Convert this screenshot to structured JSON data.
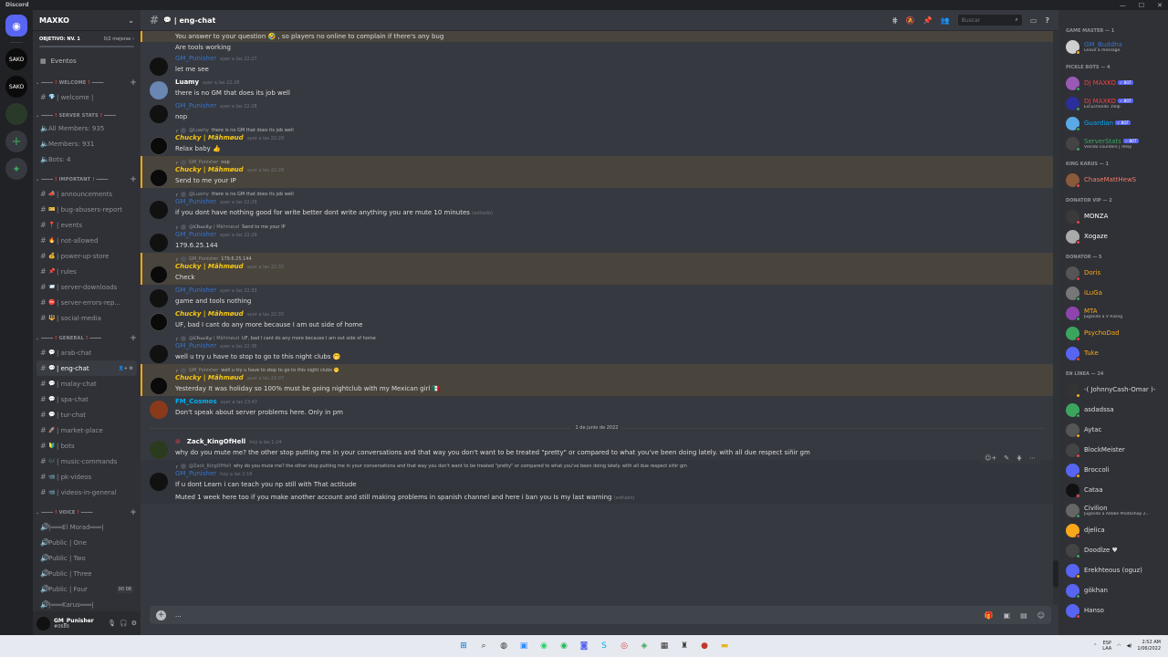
{
  "titlebar": {
    "app": "Discord",
    "min": "—",
    "max": "☐",
    "close": "✕"
  },
  "guilds": [
    "SAKO",
    "SAKO",
    ""
  ],
  "server": {
    "name": "MAXKO",
    "objective": "OBJETIVO: NV. 1",
    "objective_progress": "0/2 mejoras",
    "objective_fraction": 0.0,
    "events": "Eventos"
  },
  "categories": {
    "welcome": "WELCOME",
    "server_stats": "SERVER STATS",
    "important": "IMPORTANT",
    "general": "GENERAL",
    "voice": "VOICE"
  },
  "channels": {
    "welcome": [
      {
        "emoji": "💎",
        "name": "| welcome |"
      }
    ],
    "stats": [
      {
        "name": "All Members: 935"
      },
      {
        "name": "Members: 931"
      },
      {
        "name": "Bots: 4"
      }
    ],
    "important": [
      {
        "emoji": "📣",
        "name": "| announcements"
      },
      {
        "emoji": "🎫",
        "name": "| bug-abusers-report"
      },
      {
        "emoji": "📍",
        "name": "| events"
      },
      {
        "emoji": "🔥",
        "name": "| not-allowed"
      },
      {
        "emoji": "💰",
        "name": "| power-up-store"
      },
      {
        "emoji": "📌",
        "name": "| rules"
      },
      {
        "emoji": "📨",
        "name": "| server-downloads"
      },
      {
        "emoji": "⛔",
        "name": "| server-errors-rep..."
      },
      {
        "emoji": "🔱",
        "name": "| social-media"
      }
    ],
    "general": [
      {
        "emoji": "💬",
        "name": "| arab-chat"
      },
      {
        "emoji": "💬",
        "name": "| eng-chat",
        "active": true
      },
      {
        "emoji": "💬",
        "name": "| malay-chat"
      },
      {
        "emoji": "💬",
        "name": "| spa-chat"
      },
      {
        "emoji": "💬",
        "name": "| tur-chat"
      },
      {
        "emoji": "🚀",
        "name": "| market-place"
      },
      {
        "emoji": "🔰",
        "name": "| bots"
      },
      {
        "emoji": "🎶",
        "name": "| music-commands"
      },
      {
        "emoji": "📹",
        "name": "| pk-videos"
      },
      {
        "emoji": "📹",
        "name": "| videos-in-general"
      }
    ],
    "voice": [
      {
        "name": "|═══El Morad═══|",
        "plain": true
      },
      {
        "name": "Public | One"
      },
      {
        "name": "Public | Two"
      },
      {
        "name": "Public | Three"
      },
      {
        "name": "Public | Four",
        "badge": "00  08"
      },
      {
        "name": "|═══Karus═══|",
        "plain": true
      }
    ]
  },
  "user_panel": {
    "name": "GM_Punisher",
    "tag": "#0686"
  },
  "channel": {
    "name": "| eng-chat",
    "search_placeholder": "Buscar"
  },
  "messages": [
    {
      "type": "cont",
      "hl": true,
      "text": "You answer to your question 🤣 , so players no online to complain if there's any bug"
    },
    {
      "type": "cont",
      "text": "Are tools working"
    },
    {
      "type": "full",
      "author": "GM_Punisher",
      "style": "gm",
      "av": "gm",
      "ts": "ayer a las 22:27",
      "text": "let me see"
    },
    {
      "type": "full",
      "author": "Luamy",
      "style": "white",
      "av": "luamy",
      "ts": "ayer a las 22:28",
      "text": "there is no GM that does its job well"
    },
    {
      "type": "full",
      "author": "GM_Punisher",
      "style": "gm",
      "av": "gm",
      "ts": "ayer a las 22:28",
      "text": "nop"
    },
    {
      "type": "full",
      "reply_name": "@Luamy",
      "reply_text": "there is no GM that does its job well",
      "author": "𝘾𝙝𝙪𝙘𝙠𝙮 | Mâhmøud",
      "style": "gold",
      "av": "chucky",
      "ts": "ayer a las 22:28",
      "text": "Relax baby 👍"
    },
    {
      "type": "full",
      "hl": true,
      "reply_name": "GM_Punisher",
      "reply_text": "nop",
      "author": "𝘾𝙝𝙪𝙘𝙠𝙮 | Mâhmøud",
      "style": "gold",
      "av": "chucky",
      "ts": "ayer a las 22:28",
      "text": "Send to me your IP"
    },
    {
      "type": "full",
      "reply_name": "@Luamy",
      "reply_text": "there is no GM that does its job well",
      "author": "GM_Punisher",
      "style": "gm",
      "av": "gm",
      "ts": "ayer a las 22:29",
      "text": "if you dont have nothing good for write better dont write anything you are mute 10 minutes",
      "edited": "(editado)"
    },
    {
      "type": "full",
      "reply_name": "@𝘾𝙝𝙪𝙘𝙠𝙮 | Mâhmøud",
      "reply_text": "Send to me your IP",
      "author": "GM_Punisher",
      "style": "gm",
      "av": "gm",
      "ts": "ayer a las 22:29",
      "text": "179.6.25.144"
    },
    {
      "type": "full",
      "hl": true,
      "reply_name": "GM_Punisher",
      "reply_text": "179.6.25.144",
      "author": "𝘾𝙝𝙪𝙘𝙠𝙮 | Mâhmøud",
      "style": "gold",
      "av": "chucky",
      "ts": "ayer a las 22:32",
      "text": "Check"
    },
    {
      "type": "full",
      "author": "GM_Punisher",
      "style": "gm",
      "av": "gm",
      "ts": "ayer a las 22:33",
      "text": "game and tools nothing"
    },
    {
      "type": "full",
      "author": "𝘾𝙝𝙪𝙘𝙠𝙮 | Mâhmøud",
      "style": "gold",
      "av": "chucky",
      "ts": "ayer a las 22:35",
      "text": "UF, bad I cant do any more because I am out side of home"
    },
    {
      "type": "full",
      "reply_name": "@𝘾𝙝𝙪𝙘𝙠𝙮 | Mâhmøud",
      "reply_text": "UF, bad I cant do any more because I am out side of home",
      "author": "GM_Punisher",
      "style": "gm",
      "av": "gm",
      "ts": "ayer a las 22:36",
      "text": "well u try u have to stop to go to this night clubs 🤭"
    },
    {
      "type": "full",
      "hl": true,
      "reply_name": "GM_Punisher",
      "reply_text": "well u try u have to stop to go to this night clubs 🤭",
      "author": "𝘾𝙝𝙪𝙘𝙠𝙮 | Mâhmøud",
      "style": "gold",
      "av": "chucky",
      "ts": "ayer a las 23:07",
      "text": "Yesterday It was holiday so 100% must be going nightclub with my Mexican girl 🇲🇽"
    },
    {
      "type": "full",
      "author": "FM_Cosmos",
      "style": "cosmos",
      "av": "cosmos",
      "ts": "ayer a las 23:47",
      "text": "Don't speak about server problems here. Only in pm"
    },
    {
      "type": "date",
      "text": "1 de junio de 2022"
    },
    {
      "type": "full",
      "author": "Zack_KingOfHell",
      "style": "white",
      "av": "zack",
      "ts": "hoy a las 1:24",
      "notice": "⊘",
      "text": "why do you mute me? the other stop putting me in your conversations and that way you don't want to be treated \"pretty\" or compared to what you've been doing lately. with all due respect siñir gm"
    },
    {
      "type": "full",
      "hover": true,
      "actions": true,
      "reply_name": "@Zack_KingOfHell",
      "reply_text": "why do you mute me? the other stop putting me in your conversations and that way you don't want to be treated \"pretty\" or compared to what you've been doing lately. with all due respect siñir gm",
      "author": "GM_Punisher",
      "style": "gm",
      "av": "gm",
      "ts": "hoy a las 2:16",
      "text": "If u dont Learn i can teach you np still with That actitude"
    },
    {
      "type": "cont",
      "hover": true,
      "text": "Muted 1 week here too if you make another account and still making problems in spanish channel and here i ban you Is my last warning",
      "edited": "(editado)"
    }
  ],
  "composer": {
    "placeholder": "..."
  },
  "members": [
    {
      "cat": "GAME MASTER — 1",
      "items": [
        {
          "name": "GM_Buddha",
          "status": "Leave a message.",
          "color": "#3a73c9",
          "av": "#cfcfcf",
          "dot": "#faa81a"
        }
      ]
    },
    {
      "cat": "PICKLE BOTS — 4",
      "items": [
        {
          "name": "DJ MAXKO",
          "bot": "✓ BOT",
          "color": "#ed4245",
          "av": "#9b59b6",
          "dot": "#3ba55d"
        },
        {
          "name": "DJ MAXKO",
          "bot": "✓ BOT",
          "status": "Escuchando .help",
          "color": "#ed4245",
          "av": "#2c2f9a",
          "dot": "#3ba55d"
        },
        {
          "name": "Guardian",
          "bot": "✓ BOT",
          "color": "#00a8fc",
          "av": "#5aa9e6",
          "dot": "#3ba55d"
        },
        {
          "name": "ServerStats",
          "bot": "✓ BOT",
          "status": "Viendo counters | /help",
          "color": "#3ba55d",
          "av": "#444",
          "dot": "#3ba55d"
        }
      ]
    },
    {
      "cat": "KING KARUS — 1",
      "items": [
        {
          "name": "ChaseMattHewS",
          "color": "#f47b67",
          "av": "#8a5a3a",
          "dot": "#ed4245"
        }
      ]
    },
    {
      "cat": "DONATOR VIP — 2",
      "items": [
        {
          "name": "MONZA",
          "color": "#ffffff",
          "av": "#3a3a3a",
          "dot": "#ed4245"
        },
        {
          "name": "Xogaze",
          "color": "#ffffff",
          "av": "#aaaaaa",
          "dot": "#ed4245"
        }
      ]
    },
    {
      "cat": "DONATOR — 5",
      "items": [
        {
          "name": "Doris",
          "color": "#faa81a",
          "av": "#555",
          "dot": "#ed4245"
        },
        {
          "name": "iLuGa",
          "color": "#faa81a",
          "av": "#777",
          "dot": "#3ba55d"
        },
        {
          "name": "MTA",
          "status": "Jugando a V Rising",
          "color": "#faa81a",
          "av": "#8e44ad",
          "dot": "#3ba55d"
        },
        {
          "name": "PsychoDad",
          "color": "#faa81a",
          "av": "#3ba55d",
          "dot": "#ed4245"
        },
        {
          "name": "Tuke",
          "color": "#faa81a",
          "av": "#5865f2",
          "dot": "#ed4245"
        }
      ]
    },
    {
      "cat": "EN LÍNEA — 24",
      "items": [
        {
          "name": "-( JohnnyCash-Omar )-",
          "color": "#dcddde",
          "av": "#333",
          "dot": "#faa81a"
        },
        {
          "name": "asdadssa",
          "color": "#dcddde",
          "av": "#3ba55d",
          "dot": "#3ba55d"
        },
        {
          "name": "Aytac",
          "color": "#dcddde",
          "av": "#555",
          "dot": "#faa81a"
        },
        {
          "name": "BlockMeister",
          "color": "#dcddde",
          "av": "#444",
          "dot": "#ed4245"
        },
        {
          "name": "Broccoli",
          "color": "#dcddde",
          "av": "#5865f2",
          "dot": "#faa81a"
        },
        {
          "name": "Cataa",
          "color": "#dcddde",
          "av": "#111",
          "dot": "#ed4245"
        },
        {
          "name": "Civilion",
          "status": "Jugando a Adobe Photoshop 2...",
          "color": "#dcddde",
          "av": "#666",
          "dot": "#3ba55d"
        },
        {
          "name": "djelica",
          "color": "#dcddde",
          "av": "#faa81a",
          "dot": "#ed4245"
        },
        {
          "name": "Doodlze ♥",
          "color": "#dcddde",
          "av": "#444",
          "dot": "#3ba55d"
        },
        {
          "name": "Erekhteous (oguz)",
          "color": "#dcddde",
          "av": "#5865f2",
          "dot": "#faa81a"
        },
        {
          "name": "gökhan",
          "color": "#dcddde",
          "av": "#5865f2",
          "dot": "#3ba55d"
        },
        {
          "name": "Hanso",
          "color": "#dcddde",
          "av": "#5865f2",
          "dot": "#ed4245"
        }
      ]
    }
  ],
  "taskbar": {
    "lang": "ESP",
    "lang2": "LAA",
    "time": "2:52 AM",
    "date": "1/06/2022"
  }
}
